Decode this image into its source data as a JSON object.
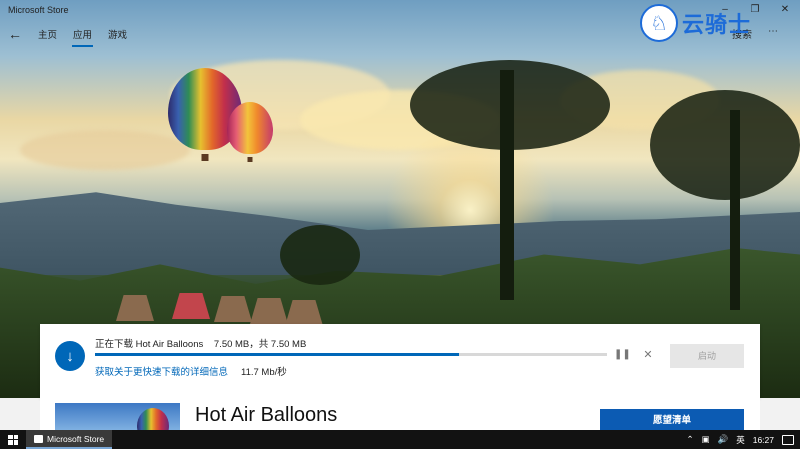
{
  "window": {
    "title": "Microsoft Store",
    "minimize_icon": "minimize-icon",
    "maximize_icon": "maximize-icon",
    "close_icon": "close-icon"
  },
  "nav": {
    "back_icon": "back-arrow-icon",
    "tabs": [
      {
        "label": "主页",
        "active": false
      },
      {
        "label": "应用",
        "active": true
      },
      {
        "label": "游戏",
        "active": false
      }
    ],
    "search_label": "搜索",
    "more_icon": "more-icon"
  },
  "watermark": {
    "text": "云骑士"
  },
  "download": {
    "status_prefix": "正在下载",
    "app_name": "Hot Air Balloons",
    "size_text": "7.50 MB，共 7.50 MB",
    "progress_percent": 71,
    "speed_link": "获取关于更快速下载的详细信息",
    "speed": "11.7 Mb/秒",
    "pause_icon": "pause-icon",
    "cancel_icon": "close-icon",
    "action_label": "启动"
  },
  "detail": {
    "app_name": "Hot Air Balloons",
    "wishlist_label": "愿望清单"
  },
  "taskbar": {
    "app_label": "Microsoft Store",
    "ime": "英",
    "time": "16:27",
    "tray_icons": [
      "chevron-up-icon",
      "network-icon",
      "volume-icon"
    ]
  },
  "colors": {
    "accent": "#0067b8",
    "wishlist_button": "#0c5bb3",
    "taskbar": "#121212",
    "watermark": "#1d6bd8"
  }
}
